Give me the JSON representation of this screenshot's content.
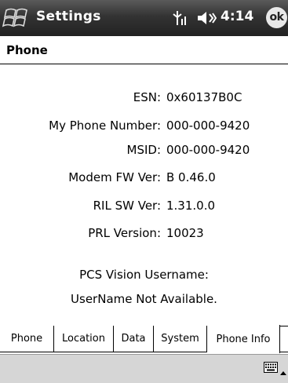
{
  "titlebar": {
    "title": "Settings",
    "time": "4:14",
    "ok_label": "ok",
    "icons": [
      "windows-start-icon",
      "signal-icon",
      "volume-icon"
    ]
  },
  "page": {
    "title": "Phone"
  },
  "info": [
    {
      "label": "ESN:",
      "value": "0x60137B0C"
    },
    {
      "label": "My Phone Number:",
      "value": "000-000-9420"
    },
    {
      "label": "MSID:",
      "value": "000-000-9420"
    },
    {
      "label": "Modem FW Ver:",
      "value": "B 0.46.0"
    },
    {
      "label": "RIL SW Ver:",
      "value": "1.31.0.0"
    },
    {
      "label": "PRL Version:",
      "value": "10023"
    }
  ],
  "pcs": {
    "heading": "PCS Vision Username:",
    "value": "UserName Not Available."
  },
  "tabs": [
    {
      "label": "Phone",
      "active": false
    },
    {
      "label": "Location",
      "active": false
    },
    {
      "label": "Data",
      "active": false
    },
    {
      "label": "System",
      "active": false
    },
    {
      "label": "Phone Info",
      "active": true
    }
  ],
  "commandbar": {
    "icons": [
      "keyboard-icon",
      "sip-arrow-up-icon"
    ]
  },
  "colors": {
    "titlebar": "#333333",
    "commandbar": "#d6d6d6",
    "background": "#ffffff"
  }
}
